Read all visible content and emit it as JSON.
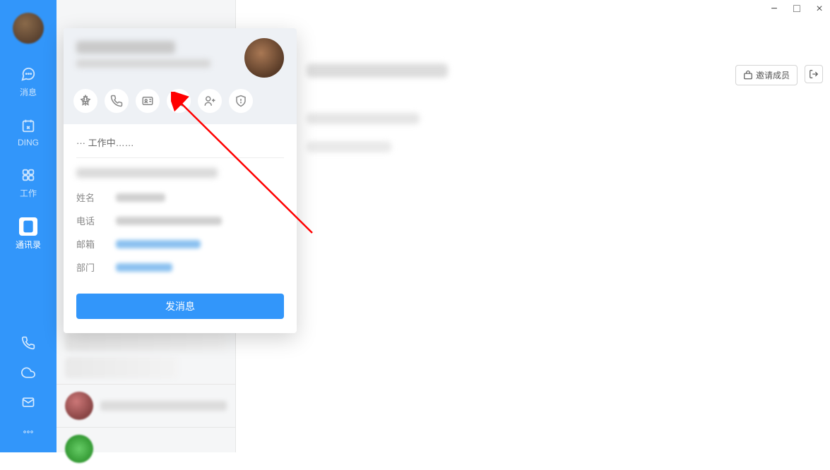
{
  "rail": {
    "items": [
      {
        "label": "消息",
        "icon": "message"
      },
      {
        "label": "DING",
        "icon": "ding"
      },
      {
        "label": "工作",
        "icon": "apps"
      },
      {
        "label": "通讯录",
        "icon": "contacts",
        "active": true
      }
    ],
    "bottom_icons": [
      "phone-icon",
      "cloud-icon",
      "mail-icon",
      "more-icon"
    ]
  },
  "profile_card": {
    "status_prefix": "···",
    "status_text": "工作中……",
    "fields": {
      "name_label": "姓名",
      "phone_label": "电话",
      "email_label": "邮箱",
      "dept_label": "部门"
    },
    "action_icons": [
      "pin-icon",
      "phone-icon",
      "card-icon",
      "star-icon",
      "add-contact-icon",
      "shield-icon"
    ],
    "send_button": "发消息"
  },
  "main_panel": {
    "invite_label": "邀请成员"
  },
  "window_controls": {
    "minimize": "−",
    "maximize": "□",
    "close": "×"
  },
  "colors": {
    "primary": "#3296FA",
    "arrow": "#FF0000"
  }
}
